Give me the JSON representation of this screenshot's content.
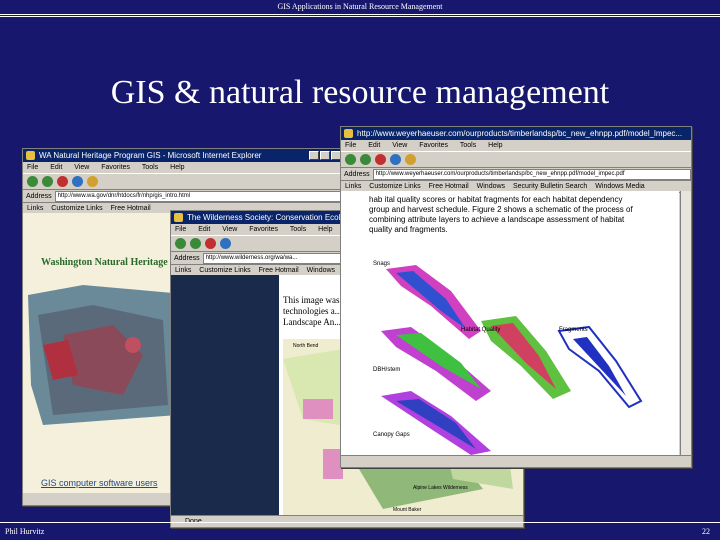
{
  "slide": {
    "header": "GIS Applications in Natural Resource Management",
    "title": "GIS & natural resource management",
    "footer_left": "Phil Hurvitz",
    "page_number": "22"
  },
  "window1": {
    "title": "WA Natural Heritage Program GIS - Microsoft Internet Explorer",
    "menu": [
      "File",
      "Edit",
      "View",
      "Favorites",
      "Tools",
      "Help"
    ],
    "address_label": "Address",
    "address": "http://www.wa.gov/dnr/htdocs/fr/nhp/gis_intro.html",
    "links_label": "Links",
    "links": [
      "Customize Links",
      "Free Hotmail"
    ],
    "heading": "Washington Natural Heritage",
    "caption": "GIS computer software users"
  },
  "window2": {
    "title": "The Wilderness Society: Conservation Ecol",
    "menu": [
      "File",
      "Edit",
      "View",
      "Favorites",
      "Tools",
      "Help"
    ],
    "address_label": "Address",
    "address": "http://www.wilderness.org/wa/wa...",
    "links_label": "Links",
    "links": [
      "Customize Links",
      "Free Hotmail",
      "Windows"
    ],
    "body_text": "This image was ... technologies a... Landscape An...",
    "map_labels": [
      "North Bend",
      "Alpine Lakes Wilderness",
      "Mount Baker"
    ],
    "status": "Done"
  },
  "window3": {
    "title": "http://www.weyerhaeuser.com/ourproducts/timberlandsp/bc_new_ehnpp.pdf/model_lmpec...",
    "menu": [
      "File",
      "Edit",
      "View",
      "Favorites",
      "Tools",
      "Help"
    ],
    "address_label": "Address",
    "address": "http://www.weyerhaeuser.com/ourproducts/timberlandsp/bc_new_ehnpp.pdf/model_impec.pdf",
    "links_label": "Links",
    "links": [
      "Customize Links",
      "Free Hotmail",
      "Windows",
      "Security Bulletin Search",
      "Windows Media"
    ],
    "paragraph": "hab ital quality scores or habitat fragments for each habitat dependency group and harvest schedule. Figure 2 shows a schematic of the process of combining attribute layers to achieve a landscape assessment of habitat quality and fragments.",
    "map_labels": [
      "Snags",
      "Habitat Quality",
      "Fragments",
      "DBH/stem",
      "Canopy Gaps"
    ]
  }
}
